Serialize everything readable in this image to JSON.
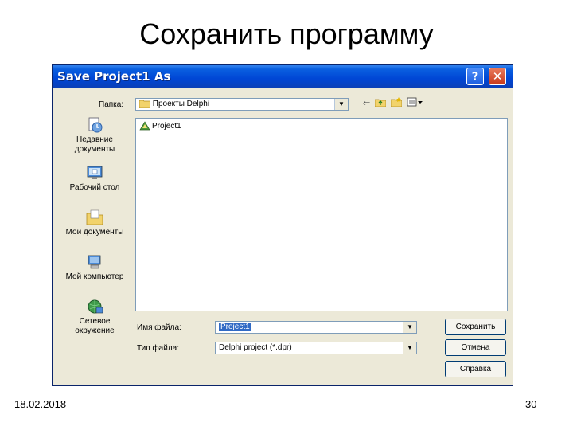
{
  "slide": {
    "title": "Сохранить программу",
    "date": "18.02.2018",
    "page_number": "30"
  },
  "dialog": {
    "title": "Save Project1 As",
    "help_label": "?",
    "close_label": "✕",
    "save_in_label": "Папка:",
    "save_in_value": "Проекты Delphi",
    "places": [
      {
        "label": "Недавние документы",
        "icon": "recent-documents-icon"
      },
      {
        "label": "Рабочий стол",
        "icon": "desktop-icon"
      },
      {
        "label": "Мои документы",
        "icon": "my-documents-icon"
      },
      {
        "label": "Мой компьютер",
        "icon": "my-computer-icon"
      },
      {
        "label": "Сетевое окружение",
        "icon": "network-places-icon"
      }
    ],
    "files": [
      {
        "name": "Project1",
        "icon": "delphi-project-icon"
      }
    ],
    "filename_label": "Имя файла:",
    "filename_value": "Project1",
    "filetype_label": "Тип файла:",
    "filetype_value": "Delphi project (*.dpr)",
    "buttons": {
      "save": "Сохранить",
      "cancel": "Отмена",
      "help": "Справка"
    }
  },
  "colors": {
    "titlebar": "#0046d5",
    "dialog_bg": "#ece9d8",
    "selection": "#316ac5"
  }
}
